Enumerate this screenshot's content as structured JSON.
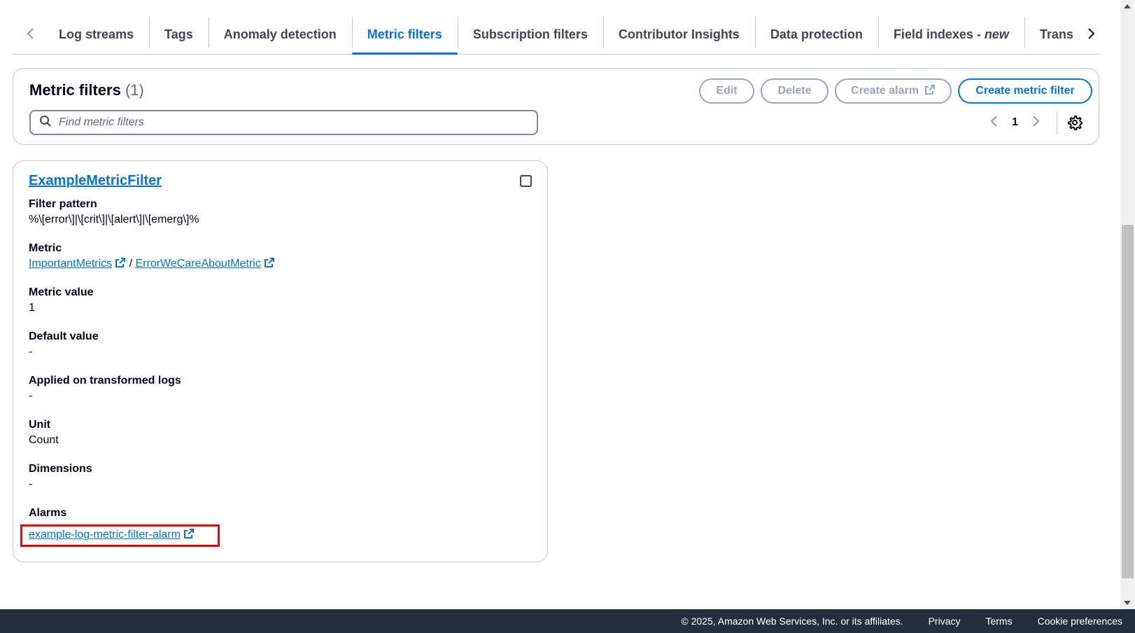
{
  "tabs": [
    {
      "label": "Log streams",
      "suffix": ""
    },
    {
      "label": "Tags",
      "suffix": ""
    },
    {
      "label": "Anomaly detection",
      "suffix": ""
    },
    {
      "label": "Metric filters",
      "suffix": ""
    },
    {
      "label": "Subscription filters",
      "suffix": ""
    },
    {
      "label": "Contributor Insights",
      "suffix": ""
    },
    {
      "label": "Data protection",
      "suffix": ""
    },
    {
      "label": "Field indexes - ",
      "suffix": "new"
    },
    {
      "label": "Trans",
      "suffix": ""
    }
  ],
  "active_tab": "Metric filters",
  "header": {
    "title": "Metric filters",
    "count": "(1)",
    "buttons": {
      "edit": "Edit",
      "delete": "Delete",
      "create_alarm": "Create alarm",
      "create_metric_filter": "Create metric filter"
    },
    "search_placeholder": "Find metric filters",
    "page_number": "1"
  },
  "card": {
    "title": "ExampleMetricFilter",
    "filter_pattern_label": "Filter pattern",
    "filter_pattern_value": "%\\[error\\]|\\[crit\\]|\\[alert\\]|\\[emerg\\]%",
    "metric_label": "Metric",
    "metric_namespace": "ImportantMetrics",
    "metric_separator": "/",
    "metric_name": "ErrorWeCareAboutMetric",
    "metric_value_label": "Metric value",
    "metric_value": "1",
    "default_value_label": "Default value",
    "default_value": "-",
    "applied_label": "Applied on transformed logs",
    "applied_value": "-",
    "unit_label": "Unit",
    "unit_value": "Count",
    "dimensions_label": "Dimensions",
    "dimensions_value": "-",
    "alarms_label": "Alarms",
    "alarm_link": "example-log-metric-filter-alarm"
  },
  "footer": {
    "copyright": "© 2025, Amazon Web Services, Inc. or its affiliates.",
    "privacy": "Privacy",
    "terms": "Terms",
    "cookies": "Cookie preferences"
  },
  "colors": {
    "link": "#0972d3",
    "highlight": "#e8000b",
    "footer_bg": "#232f3e"
  }
}
